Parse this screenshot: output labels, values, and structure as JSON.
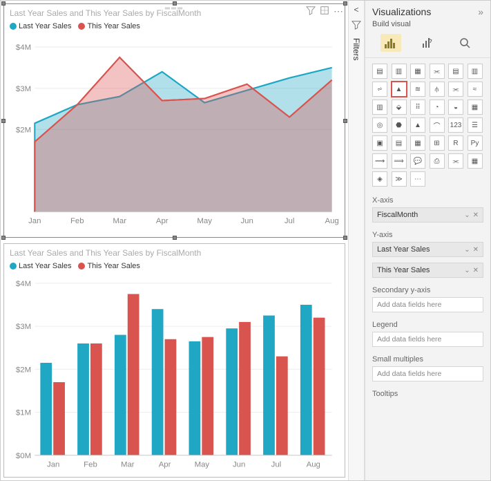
{
  "chart_data": [
    {
      "type": "area",
      "title": "Last Year Sales and This Year Sales by FiscalMonth",
      "xlabel": "",
      "ylabel": "",
      "categories": [
        "Jan",
        "Feb",
        "Mar",
        "Apr",
        "May",
        "Jun",
        "Jul",
        "Aug"
      ],
      "ylim": [
        0,
        4000000
      ],
      "yticks": [
        "$2M",
        "$3M",
        "$4M"
      ],
      "series": [
        {
          "name": "Last Year Sales",
          "color": "#1fa7c4",
          "values": [
            2150000,
            2600000,
            2800000,
            3400000,
            2650000,
            2950000,
            3250000,
            3500000
          ]
        },
        {
          "name": "This Year Sales",
          "color": "#d9534f",
          "values": [
            1700000,
            2600000,
            3750000,
            2700000,
            2750000,
            3100000,
            2300000,
            3200000
          ]
        }
      ]
    },
    {
      "type": "bar",
      "title": "Last Year Sales and This Year Sales by FiscalMonth",
      "xlabel": "",
      "ylabel": "",
      "categories": [
        "Jan",
        "Feb",
        "Mar",
        "Apr",
        "May",
        "Jun",
        "Jul",
        "Aug"
      ],
      "ylim": [
        0,
        4000000
      ],
      "yticks": [
        "$0M",
        "$1M",
        "$2M",
        "$3M",
        "$4M"
      ],
      "series": [
        {
          "name": "Last Year Sales",
          "color": "#1fa7c4",
          "values": [
            2150000,
            2600000,
            2800000,
            3400000,
            2650000,
            2950000,
            3250000,
            3500000
          ]
        },
        {
          "name": "This Year Sales",
          "color": "#d9534f",
          "values": [
            1700000,
            2600000,
            3750000,
            2700000,
            2750000,
            3100000,
            2300000,
            3200000
          ]
        }
      ]
    }
  ],
  "legend": {
    "s1": "Last Year Sales",
    "s2": "This Year Sales"
  },
  "filters_label": "Filters",
  "viz": {
    "title": "Visualizations",
    "subtitle": "Build visual",
    "expand": "»",
    "collapse": "<",
    "fields": {
      "xaxis_label": "X-axis",
      "xaxis_value": "FiscalMonth",
      "yaxis_label": "Y-axis",
      "yaxis_value1": "Last Year Sales",
      "yaxis_value2": "This Year Sales",
      "secy_label": "Secondary y-axis",
      "secy_ph": "Add data fields here",
      "legend_label": "Legend",
      "legend_ph": "Add data fields here",
      "sm_label": "Small multiples",
      "sm_ph": "Add data fields here",
      "tooltips_label": "Tooltips"
    }
  },
  "colors": {
    "s1": "#1fa7c4",
    "s2": "#d9534f"
  }
}
